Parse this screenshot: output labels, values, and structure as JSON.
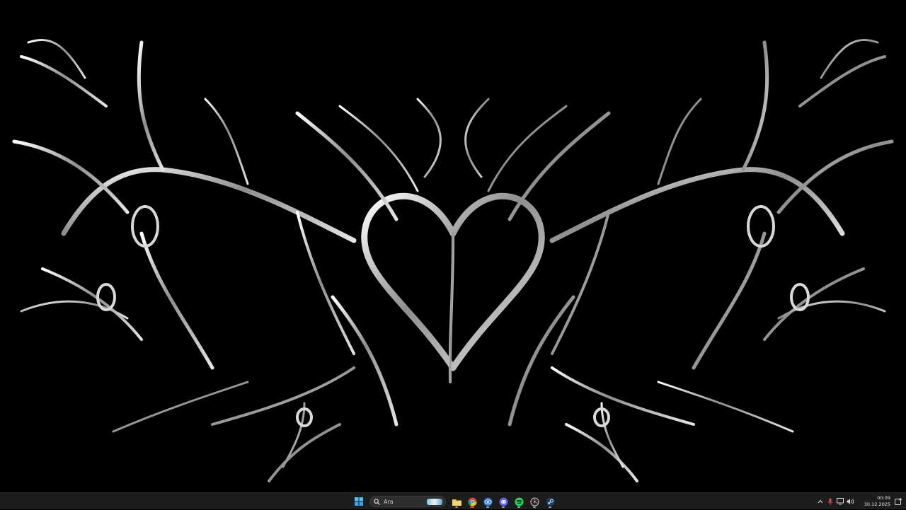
{
  "taskbar": {
    "search": {
      "label": "Ara"
    },
    "apps": [
      {
        "name": "start-icon"
      },
      {
        "name": "file-explorer-icon"
      },
      {
        "name": "chrome-icon"
      },
      {
        "name": "browser-icon"
      },
      {
        "name": "discord-icon"
      },
      {
        "name": "spotify-icon"
      },
      {
        "name": "app-icon"
      },
      {
        "name": "steam-icon"
      }
    ],
    "tray": {
      "time": "00:09",
      "date": "30.12.2025"
    }
  },
  "colors": {
    "taskbar_bg": "#1c1c1c",
    "wallpaper_bg": "#000000",
    "accent_active": "#c84040"
  }
}
